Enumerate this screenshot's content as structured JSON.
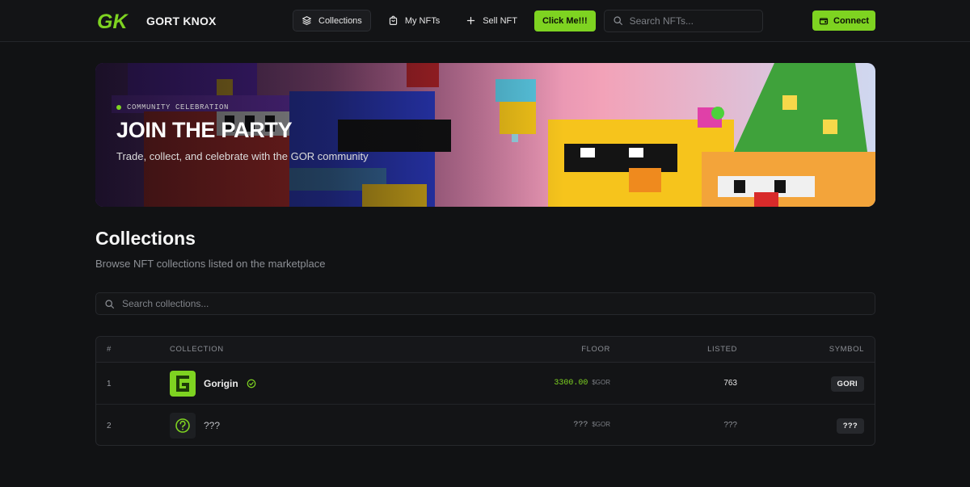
{
  "brand": {
    "name": "GORT KNOX",
    "logo_text": "GK",
    "accent_color": "#7ed321"
  },
  "nav": {
    "items": [
      {
        "label": "Collections",
        "icon": "layers-icon",
        "active": true
      },
      {
        "label": "My NFTs",
        "icon": "bag-icon",
        "active": false
      },
      {
        "label": "Sell NFT",
        "icon": "plus-icon",
        "active": false
      }
    ],
    "cta_label": "Click Me!!!",
    "search_placeholder": "Search NFTs...",
    "connect_label": "Connect",
    "connect_icon": "wallet-icon"
  },
  "banner": {
    "eyebrow": "COMMUNITY CELEBRATION",
    "title": "JOIN THE PARTY",
    "subtitle": "Trade, collect, and celebrate with the GOR community"
  },
  "collections": {
    "title": "Collections",
    "subtitle": "Browse NFT collections listed on the marketplace",
    "search_placeholder": "Search collections...",
    "columns": {
      "rank": "#",
      "collection": "COLLECTION",
      "floor": "FLOOR",
      "listed": "LISTED",
      "symbol": "SYMBOL"
    },
    "rows": [
      {
        "rank": "1",
        "name": "Gorigin",
        "verified": true,
        "floor": "3300.00",
        "unit": "$GOR",
        "listed": "763",
        "symbol": "GORI",
        "thumb_icon": "gorigin-logo-icon"
      },
      {
        "rank": "2",
        "name": "???",
        "verified": false,
        "floor": "???",
        "unit": "$GOR",
        "listed": "???",
        "symbol": "???",
        "thumb_icon": "question-icon"
      }
    ]
  }
}
